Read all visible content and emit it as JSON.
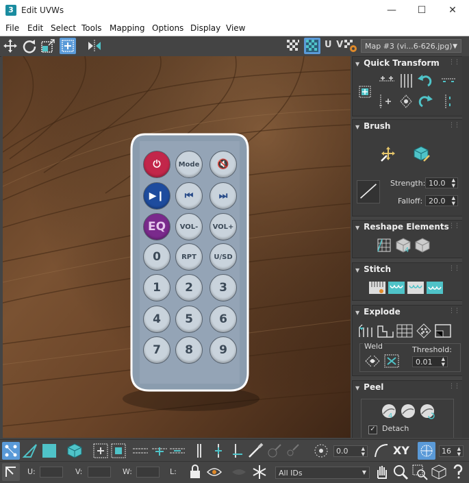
{
  "window": {
    "title": "Edit UVWs",
    "app_icon_label": "3"
  },
  "menu": [
    "File",
    "Edit",
    "Select",
    "Tools",
    "Mapping",
    "Options",
    "Display",
    "View"
  ],
  "toolbar": {
    "uv_label": "U V",
    "map_select": "Map #3 (vi...6-626.jpg)"
  },
  "remote": {
    "buttons": [
      [
        "",
        "Mode",
        ""
      ],
      [
        "",
        "",
        ""
      ],
      [
        "EQ",
        "VOL-",
        "VOL+"
      ],
      [
        "0",
        "RPT",
        "U/SD"
      ],
      [
        "1",
        "2",
        "3"
      ],
      [
        "4",
        "5",
        "6"
      ],
      [
        "7",
        "8",
        "9"
      ]
    ]
  },
  "panel": {
    "quick_transform": {
      "title": "Quick Transform"
    },
    "brush": {
      "title": "Brush",
      "strength_label": "Strength:",
      "strength_value": "10.0",
      "falloff_label": "Falloff:",
      "falloff_value": "20.0"
    },
    "reshape": {
      "title": "Reshape Elements"
    },
    "stitch": {
      "title": "Stitch"
    },
    "explode": {
      "title": "Explode",
      "weld_label": "Weld",
      "threshold_label": "Threshold:",
      "threshold_value": "0.01"
    },
    "peel": {
      "title": "Peel",
      "detach_label": "Detach"
    }
  },
  "bottombar": {
    "angle_value": "0.0",
    "xy_label": "XY",
    "grid_value": "16",
    "u_label": "U:",
    "v_label": "V:",
    "w_label": "W:",
    "l_label": "L:",
    "ids_select": "All IDs"
  },
  "colors": {
    "accent": "#4fc3c8",
    "active_blue": "#5a9ad8",
    "background": "#444444"
  }
}
